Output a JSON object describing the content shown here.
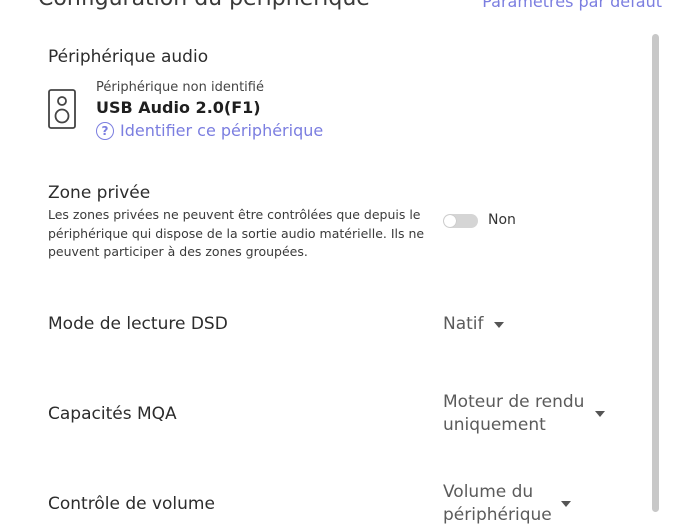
{
  "header": {
    "title": "Configuration du périphérique",
    "reset_link": "Paramètres par défaut"
  },
  "audio_device": {
    "section_label": "Périphérique audio",
    "status": "Périphérique non identifié",
    "name": "USB Audio 2.0(F1)",
    "identify_link": "Identifier ce périphérique",
    "icon": "speaker-icon",
    "help_icon": "question-circle-icon"
  },
  "private_zone": {
    "label": "Zone privée",
    "description": "Les zones privées ne peuvent être contrôlées que depuis le périphérique qui dispose de la sortie audio matérielle. Ils ne peuvent participer à des zones groupées.",
    "toggle_state": "Non",
    "enabled": false
  },
  "dsd_mode": {
    "label": "Mode de lecture DSD",
    "value": "Natif"
  },
  "mqa": {
    "label": "Capacités MQA",
    "value": "Moteur de rendu uniquement"
  },
  "volume_control": {
    "label": "Contrôle de volume",
    "value": "Volume du périphérique"
  },
  "colors": {
    "accent": "#7b7ee0",
    "text": "#2c2c2c",
    "toggle_off": "#d5d5d5",
    "scrollbar": "#c8c8c8"
  }
}
